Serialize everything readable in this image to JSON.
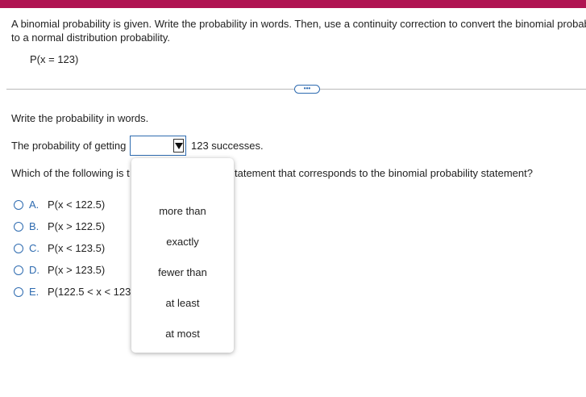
{
  "colors": {
    "accent": "#b01452",
    "link": "#2e6bb0"
  },
  "prompt": {
    "line1": "A binomial probability is given. Write the probability in words. Then, use a continuity correction to convert the binomial probabi",
    "line2": "to a normal distribution probability.",
    "expression": "P(x = 123)"
  },
  "more_button": {
    "label": "•••"
  },
  "question1": {
    "heading": "Write the probability in words.",
    "sentence_prefix": "The probability of getting",
    "sentence_suffix": "123 successes.",
    "select_value": ""
  },
  "question2": {
    "text_visible_start": "Which of the following is t",
    "text_visible_end": "tatement that corresponds to the binomial probability statement?"
  },
  "options": [
    {
      "letter": "A.",
      "text": "P(x < 122.5)"
    },
    {
      "letter": "B.",
      "text": "P(x > 122.5)"
    },
    {
      "letter": "C.",
      "text": "P(x < 123.5)"
    },
    {
      "letter": "D.",
      "text": "P(x > 123.5)"
    },
    {
      "letter": "E.",
      "text": "P(122.5 < x < 123."
    }
  ],
  "dropdown_items": [
    "more than",
    "exactly",
    "fewer than",
    "at least",
    "at most"
  ]
}
